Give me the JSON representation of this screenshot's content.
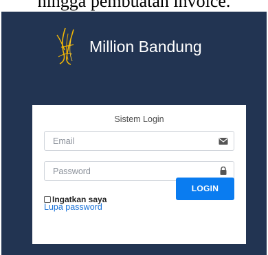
{
  "caption": {
    "text": "hingga pembuatan invoice."
  },
  "brand": {
    "name": "Million Bandung"
  },
  "login": {
    "title": "Sistem Login",
    "email_placeholder": "Email",
    "password_placeholder": "Password",
    "remember_label": "Ingatkan saya",
    "remember_checked": false,
    "login_button": "LOGIN",
    "forgot_link": "Lupa password"
  },
  "icons": {
    "email": "envelope-icon",
    "password": "lock-icon",
    "logo": "brand-logo-icon"
  },
  "colors": {
    "background": "#223452",
    "card": "#ffffff",
    "button": "#0a7cf0",
    "link": "#1a73d9",
    "logo_gold": "#f2b705"
  }
}
